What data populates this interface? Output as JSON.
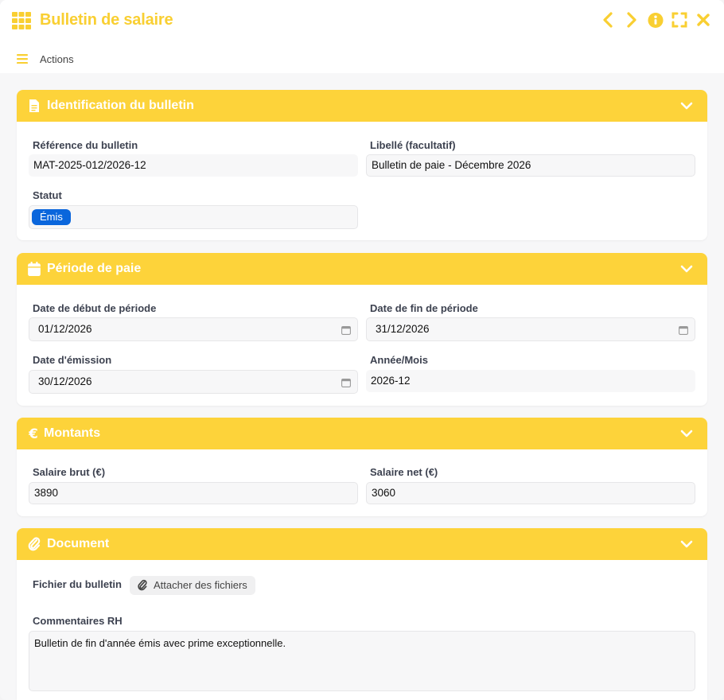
{
  "window": {
    "title": "Bulletin de salaire",
    "accent": "#fdd33a",
    "title_color": "#f9cf32",
    "controls": [
      "chevron-left-icon",
      "chevron-right-icon",
      "info-icon",
      "fullscreen-icon",
      "close-icon"
    ]
  },
  "toolbar": {
    "actions_label": "Actions"
  },
  "sections": {
    "identification": {
      "title": "Identification du bulletin",
      "icon": "document-icon",
      "reference_label": "Référence du bulletin",
      "reference_value": "MAT-2025-012/2026-12",
      "libelle_label": "Libellé (facultatif)",
      "libelle_value": "Bulletin de paie - Décembre 2026",
      "statut_label": "Statut",
      "statut_value": "Émis",
      "statut_color": "#0a66dc"
    },
    "periode": {
      "title": "Période de paie",
      "icon": "calendar-icon",
      "debut_label": "Date de début de période",
      "debut_value": "01/12/2026",
      "fin_label": "Date de fin de période",
      "fin_value": "31/12/2026",
      "emission_label": "Date d'émission",
      "emission_value": "30/12/2026",
      "annee_mois_label": "Année/Mois",
      "annee_mois_value": "2026-12"
    },
    "montants": {
      "title": "Montants",
      "icon": "euro-icon",
      "brut_label": "Salaire brut (€)",
      "brut_value": "3890",
      "net_label": "Salaire net (€)",
      "net_value": "3060"
    },
    "document": {
      "title": "Document",
      "icon": "paperclip-icon",
      "fichier_label": "Fichier du bulletin",
      "attach_label": "Attacher des fichiers",
      "commentaires_label": "Commentaires RH",
      "commentaires_value": "Bulletin de fin d'année émis avec prime exceptionnelle."
    }
  }
}
